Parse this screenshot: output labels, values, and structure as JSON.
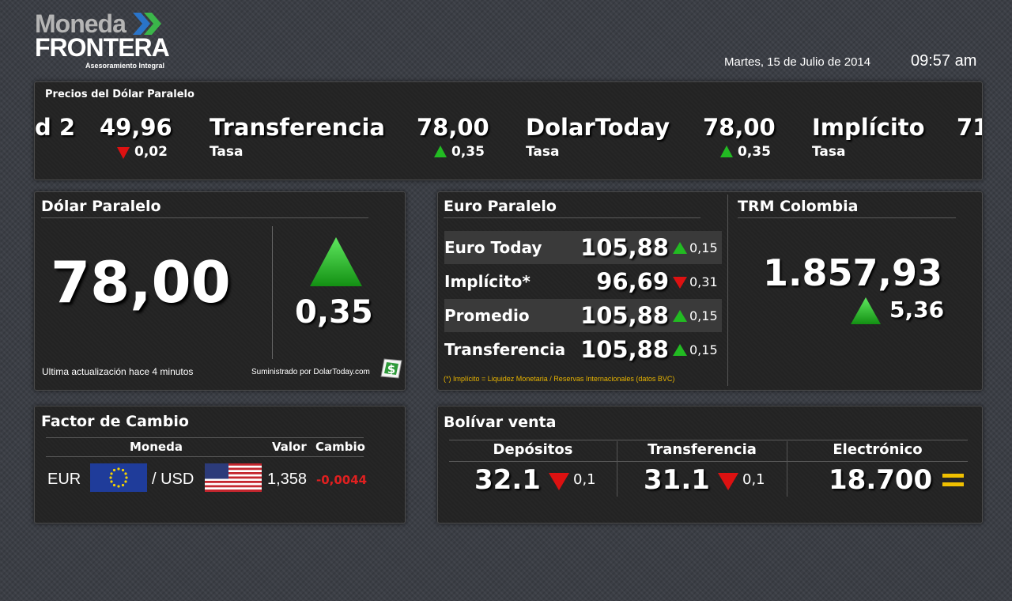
{
  "logo": {
    "line1": "Moneda",
    "line2": "FRONTERA",
    "tagline": "Asesoramiento Integral"
  },
  "header": {
    "date": "Martes, 15 de Julio de 2014",
    "time": "09:57 am"
  },
  "ticker": {
    "title": "Precios del Dólar Paralelo",
    "items": [
      {
        "name": "d 2",
        "value": "49,96",
        "direction": "down",
        "change": "0,02",
        "sub": ""
      },
      {
        "name": "Transferencia",
        "value": "78,00",
        "direction": "up",
        "change": "0,35",
        "sub": "Tasa"
      },
      {
        "name": "DolarToday",
        "value": "78,00",
        "direction": "up",
        "change": "0,35",
        "sub": "Tasa"
      },
      {
        "name": "Implícito",
        "value": "71",
        "direction": "",
        "change": "",
        "sub": "Tasa"
      }
    ]
  },
  "dolar": {
    "title": "Dólar Paralelo",
    "value": "78,00",
    "direction": "up",
    "change": "0,35",
    "updated": "Ultima actualización hace 4 minutos",
    "source": "Suministrado por DolarToday.com",
    "source_icon": "dollar-badge-icon"
  },
  "euro": {
    "title": "Euro Paralelo",
    "rows": [
      {
        "name": "Euro Today",
        "value": "105,88",
        "direction": "up",
        "change": "0,15"
      },
      {
        "name": "Implícito*",
        "value": "96,69",
        "direction": "down",
        "change": "0,31"
      },
      {
        "name": "Promedio",
        "value": "105,88",
        "direction": "up",
        "change": "0,15"
      },
      {
        "name": "Transferencia",
        "value": "105,88",
        "direction": "up",
        "change": "0,15"
      }
    ],
    "footnote": "(*) Implícito = Liquidez Monetaria / Reservas Internacionales (datos BVC)"
  },
  "trm": {
    "title": "TRM Colombia",
    "value": "1.857,93",
    "direction": "up",
    "change": "5,36"
  },
  "factor": {
    "title": "Factor de Cambio",
    "headers": {
      "moneda": "Moneda",
      "valor": "Valor",
      "cambio": "Cambio"
    },
    "from": "EUR",
    "to": "/ USD",
    "value": "1,358",
    "change": "-0,0044"
  },
  "bolivar": {
    "title": "Bolívar venta",
    "columns": [
      {
        "label": "Depósitos",
        "value": "32.1",
        "direction": "down",
        "change": "0,1"
      },
      {
        "label": "Transferencia",
        "value": "31.1",
        "direction": "down",
        "change": "0,1"
      },
      {
        "label": "Electrónico",
        "value": "18.700",
        "direction": "equal",
        "change": ""
      }
    ]
  },
  "colors": {
    "up": "#22bb22",
    "down": "#dd1111",
    "equal": "#f0c000",
    "negative": "#e02020",
    "footnote": "#e8b400"
  }
}
